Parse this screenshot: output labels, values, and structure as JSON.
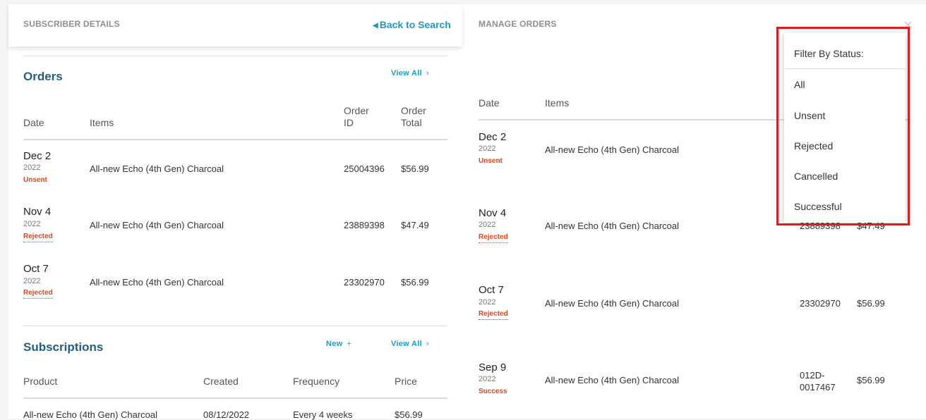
{
  "left": {
    "header_title": "SUBSCRIBER DETAILS",
    "back_label": "Back to Search",
    "orders": {
      "title": "Orders",
      "view_all": "View All",
      "columns": {
        "date": "Date",
        "items": "Items",
        "order_id_1": "Order",
        "order_id_2": "ID",
        "order_total_1": "Order",
        "order_total_2": "Total"
      },
      "rows": [
        {
          "date": "Dec 2",
          "year": "2022",
          "status": "Unsent",
          "item": "All-new Echo (4th Gen) Charcoal",
          "id": "25004396",
          "total": "$56.99"
        },
        {
          "date": "Nov 4",
          "year": "2022",
          "status": "Rejected",
          "item": "All-new Echo (4th Gen) Charcoal",
          "id": "23889398",
          "total": "$47.49"
        },
        {
          "date": "Oct 7",
          "year": "2022",
          "status": "Rejected",
          "item": "All-new Echo (4th Gen) Charcoal",
          "id": "23302970",
          "total": "$56.99"
        }
      ]
    },
    "subscriptions": {
      "title": "Subscriptions",
      "new_label": "New",
      "view_all": "View All",
      "columns": {
        "product": "Product",
        "created": "Created",
        "frequency": "Frequency",
        "price": "Price"
      },
      "rows": [
        {
          "product": "All-new Echo (4th Gen) Charcoal",
          "created": "08/12/2022",
          "frequency": "Every 4 weeks",
          "price": "$56.99"
        }
      ]
    }
  },
  "right": {
    "header_title": "MANAGE ORDERS",
    "columns": {
      "date": "Date",
      "items": "Items"
    },
    "rows": [
      {
        "date": "Dec 2",
        "year": "2022",
        "status": "Unsent",
        "item": "All-new Echo (4th Gen) Charcoal",
        "id": "",
        "total": ""
      },
      {
        "date": "Nov 4",
        "year": "2022",
        "status": "Rejected",
        "item": "All-new Echo (4th Gen) Charcoal",
        "id": "23889398",
        "total": "$47.49"
      },
      {
        "date": "Oct 7",
        "year": "2022",
        "status": "Rejected",
        "item": "All-new Echo (4th Gen) Charcoal",
        "id": "23302970",
        "total": "$56.99"
      },
      {
        "date": "Sep 9",
        "year": "2022",
        "status": "Success",
        "item": "All-new Echo (4th Gen) Charcoal",
        "id_1": "012D-",
        "id_2": "0017467",
        "total": "$56.99"
      }
    ],
    "filter": {
      "title": "Filter By Status:",
      "options": [
        "All",
        "Unsent",
        "Rejected",
        "Cancelled",
        "Successful"
      ]
    }
  },
  "colors": {
    "accent": "#1a9bc7",
    "section_title": "#1f5f84",
    "status": "#e2451b",
    "highlight": "#e11b1b"
  }
}
